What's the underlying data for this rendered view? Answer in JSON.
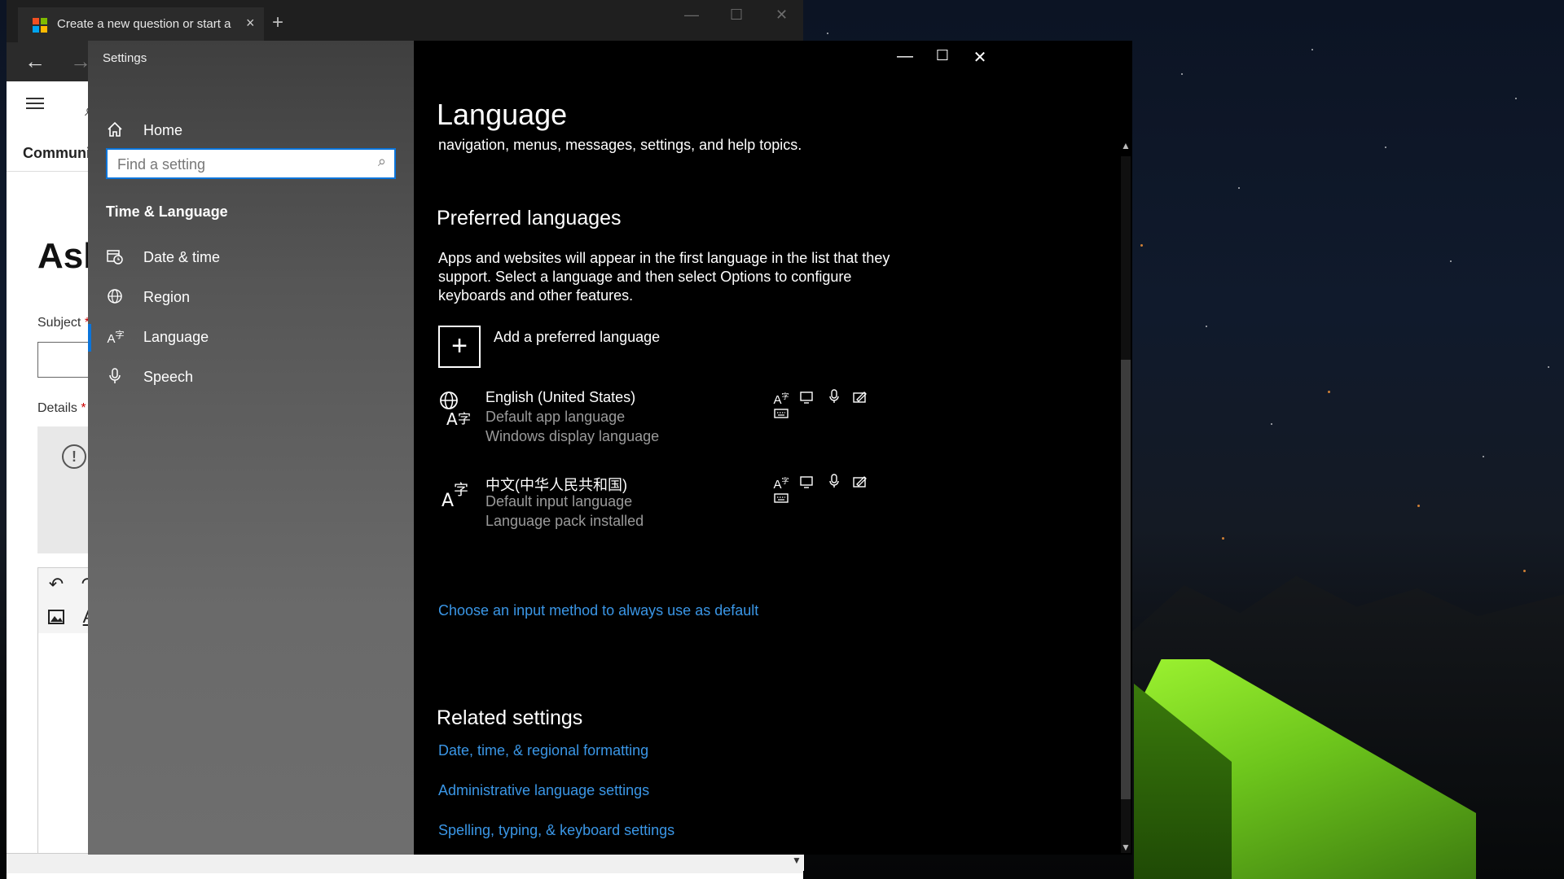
{
  "browser": {
    "tab_title": "Create a new question or start a",
    "tab_close": "×",
    "new_tab": "+",
    "window_controls": {
      "minimize": "—",
      "maximize": "☐",
      "close": "✕"
    },
    "back": "←",
    "forward": "→",
    "community": "Communi",
    "page_heading": "Ask",
    "subject_label": "Subject",
    "details_label": "Details",
    "required_mark": "*",
    "info_glyph": "!",
    "undo_glyph": "↶",
    "redo_glyph": "↷",
    "font_glyph": "A"
  },
  "settings": {
    "app_title": "Settings",
    "window_controls": {
      "minimize": "—",
      "maximize": "☐",
      "close": "✕"
    },
    "sidebar": {
      "home_label": "Home",
      "search_placeholder": "Find a setting",
      "section_title": "Time & Language",
      "items": [
        {
          "label": "Date & time",
          "icon": "calendar-clock-icon"
        },
        {
          "label": "Region",
          "icon": "globe-icon"
        },
        {
          "label": "Language",
          "icon": "language-icon",
          "active": true
        },
        {
          "label": "Speech",
          "icon": "microphone-icon"
        }
      ]
    },
    "main": {
      "title": "Language",
      "intro": "navigation, menus, messages, settings, and help topics.",
      "preferred_heading": "Preferred languages",
      "preferred_desc": "Apps and websites will appear in the first language in the list that they support. Select a language and then select Options to configure keyboards and other features.",
      "add_label": "Add a preferred language",
      "add_glyph": "+",
      "languages": [
        {
          "name": "English (United States)",
          "line2": "Default app language",
          "line3": "Windows display language",
          "icon": "language-globe-icon"
        },
        {
          "name": "中文(中华人民共和国)",
          "line2": "Default input language",
          "line3": "Language pack installed",
          "icon": "language-icon"
        }
      ],
      "feature_icons": [
        "language-pack-icon",
        "display-icon",
        "speech-icon",
        "handwriting-icon",
        "keyboard-icon"
      ],
      "input_method_link": "Choose an input method to always use as default",
      "related_heading": "Related settings",
      "related_links": [
        "Date, time, & regional formatting",
        "Administrative language settings",
        "Spelling, typing, & keyboard settings"
      ]
    },
    "scroll": {
      "up": "▲",
      "down": "▼"
    }
  },
  "colors": {
    "accent": "#0a74da",
    "link": "#3a96e6",
    "secondary_text": "#9a9a9a",
    "tent": "#7ad61e"
  }
}
